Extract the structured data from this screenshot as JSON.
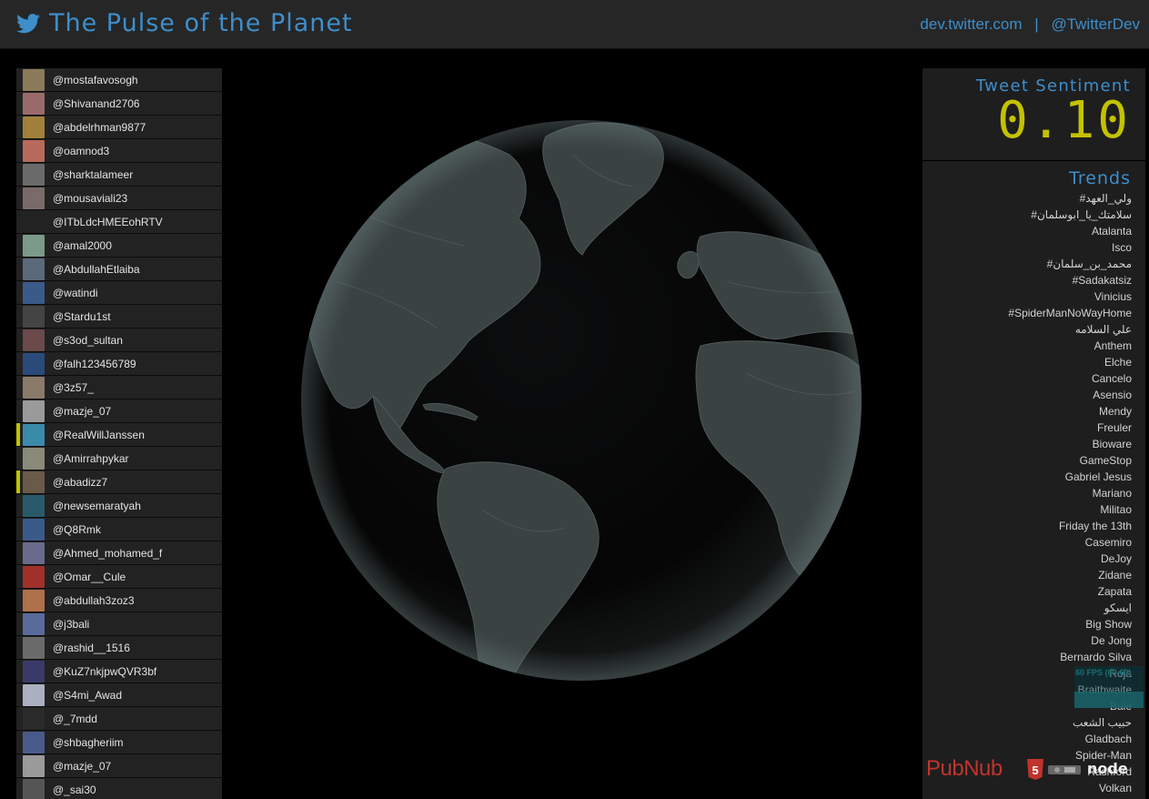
{
  "header": {
    "icon": "twitter-bird-icon",
    "title": "The Pulse of the Planet",
    "link_dev": "dev.twitter.com",
    "separator": "|",
    "link_handle": "@TwitterDev",
    "accent_color": "#3d8ecb"
  },
  "users": [
    {
      "handle": "@mostafavosogh",
      "highlight": false
    },
    {
      "handle": "@Shivanand2706",
      "highlight": false
    },
    {
      "handle": "@abdelrhman9877",
      "highlight": false
    },
    {
      "handle": "@oamnod3",
      "highlight": false
    },
    {
      "handle": "@sharktalameer",
      "highlight": false
    },
    {
      "handle": "@mousaviali23",
      "highlight": false
    },
    {
      "handle": "@ITbLdcHMEEohRTV",
      "highlight": false
    },
    {
      "handle": "@amal2000",
      "highlight": false
    },
    {
      "handle": "@AbdullahEtlaiba",
      "highlight": false
    },
    {
      "handle": "@watindi",
      "highlight": false
    },
    {
      "handle": "@Stardu1st",
      "highlight": false
    },
    {
      "handle": "@s3od_sultan",
      "highlight": false
    },
    {
      "handle": "@falh123456789",
      "highlight": false
    },
    {
      "handle": "@3z57_",
      "highlight": false
    },
    {
      "handle": "@mazje_07",
      "highlight": false
    },
    {
      "handle": "@RealWillJanssen",
      "highlight": true
    },
    {
      "handle": "@Amirrahpykar",
      "highlight": false
    },
    {
      "handle": "@abadizz7",
      "highlight": true
    },
    {
      "handle": "@newsemaratyah",
      "highlight": false
    },
    {
      "handle": "@Q8Rmk",
      "highlight": false
    },
    {
      "handle": "@Ahmed_mohamed_f",
      "highlight": false
    },
    {
      "handle": "@Omar__Cule",
      "highlight": false
    },
    {
      "handle": "@abdullah3zoz3",
      "highlight": false
    },
    {
      "handle": "@j3bali",
      "highlight": false
    },
    {
      "handle": "@rashid__1516",
      "highlight": false
    },
    {
      "handle": "@KuZ7nkjpwQVR3bf",
      "highlight": false
    },
    {
      "handle": "@S4mi_Awad",
      "highlight": false
    },
    {
      "handle": "@_7mdd",
      "highlight": false
    },
    {
      "handle": "@shbagheriim",
      "highlight": false
    },
    {
      "handle": "@mazje_07",
      "highlight": false
    },
    {
      "handle": "@_sai30",
      "highlight": false
    }
  ],
  "sentiment": {
    "label": "Tweet Sentiment",
    "value": "0.10",
    "value_color": "#c3c200"
  },
  "trends": {
    "title": "Trends",
    "items": [
      "#ولي_العهد",
      "#سلامتك_يا_ابوسلمان",
      "Atalanta",
      "Isco",
      "#محمد_بن_سلمان",
      "#Sadakatsiz",
      "Vinicius",
      "#SpiderManNoWayHome",
      "علي السلامه",
      "Anthem",
      "Elche",
      "Cancelo",
      "Asensio",
      "Mendy",
      "Freuler",
      "Bioware",
      "GameStop",
      "Gabriel Jesus",
      "Mariano",
      "Militao",
      "Friday the 13th",
      "Casemiro",
      "DeJoy",
      "Zidane",
      "Zapata",
      "ايسكو",
      "Big Show",
      "De Jong",
      "Bernardo Silva",
      "Roja",
      "Braithwaite",
      "Bale",
      "حبيب الشعب",
      "Gladbach",
      "Spider-Man",
      "Rashford",
      "Volkan"
    ]
  },
  "fps": {
    "label": "60 FPS (60-60)"
  },
  "footer_logos": {
    "pubnub": "PubNub",
    "html5_badge": "5",
    "node": "node"
  }
}
